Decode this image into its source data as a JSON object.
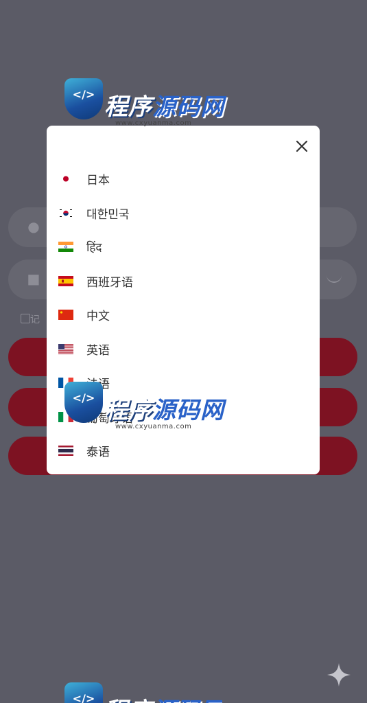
{
  "background": {
    "remember_label": "记住"
  },
  "language_modal": {
    "close_label": "×",
    "languages": [
      {
        "label": "日本",
        "flag": "japan"
      },
      {
        "label": "대한민국",
        "flag": "korea"
      },
      {
        "label": "हिंद",
        "flag": "india"
      },
      {
        "label": "西班牙语",
        "flag": "spain"
      },
      {
        "label": "中文",
        "flag": "china"
      },
      {
        "label": "英语",
        "flag": "usa"
      },
      {
        "label": "法语",
        "flag": "france"
      },
      {
        "label": "葡萄牙语",
        "flag": "italy"
      },
      {
        "label": "泰语",
        "flag": "thailand"
      }
    ]
  },
  "watermark": {
    "code_glyph": "</>",
    "title_part1": "程序",
    "title_part2": "源码网",
    "url": "www.cxyuanma.com"
  },
  "colors": {
    "overlay": "#5b5b66",
    "accent": "#7d1222",
    "modal_bg": "#ffffff",
    "text": "#333333"
  }
}
